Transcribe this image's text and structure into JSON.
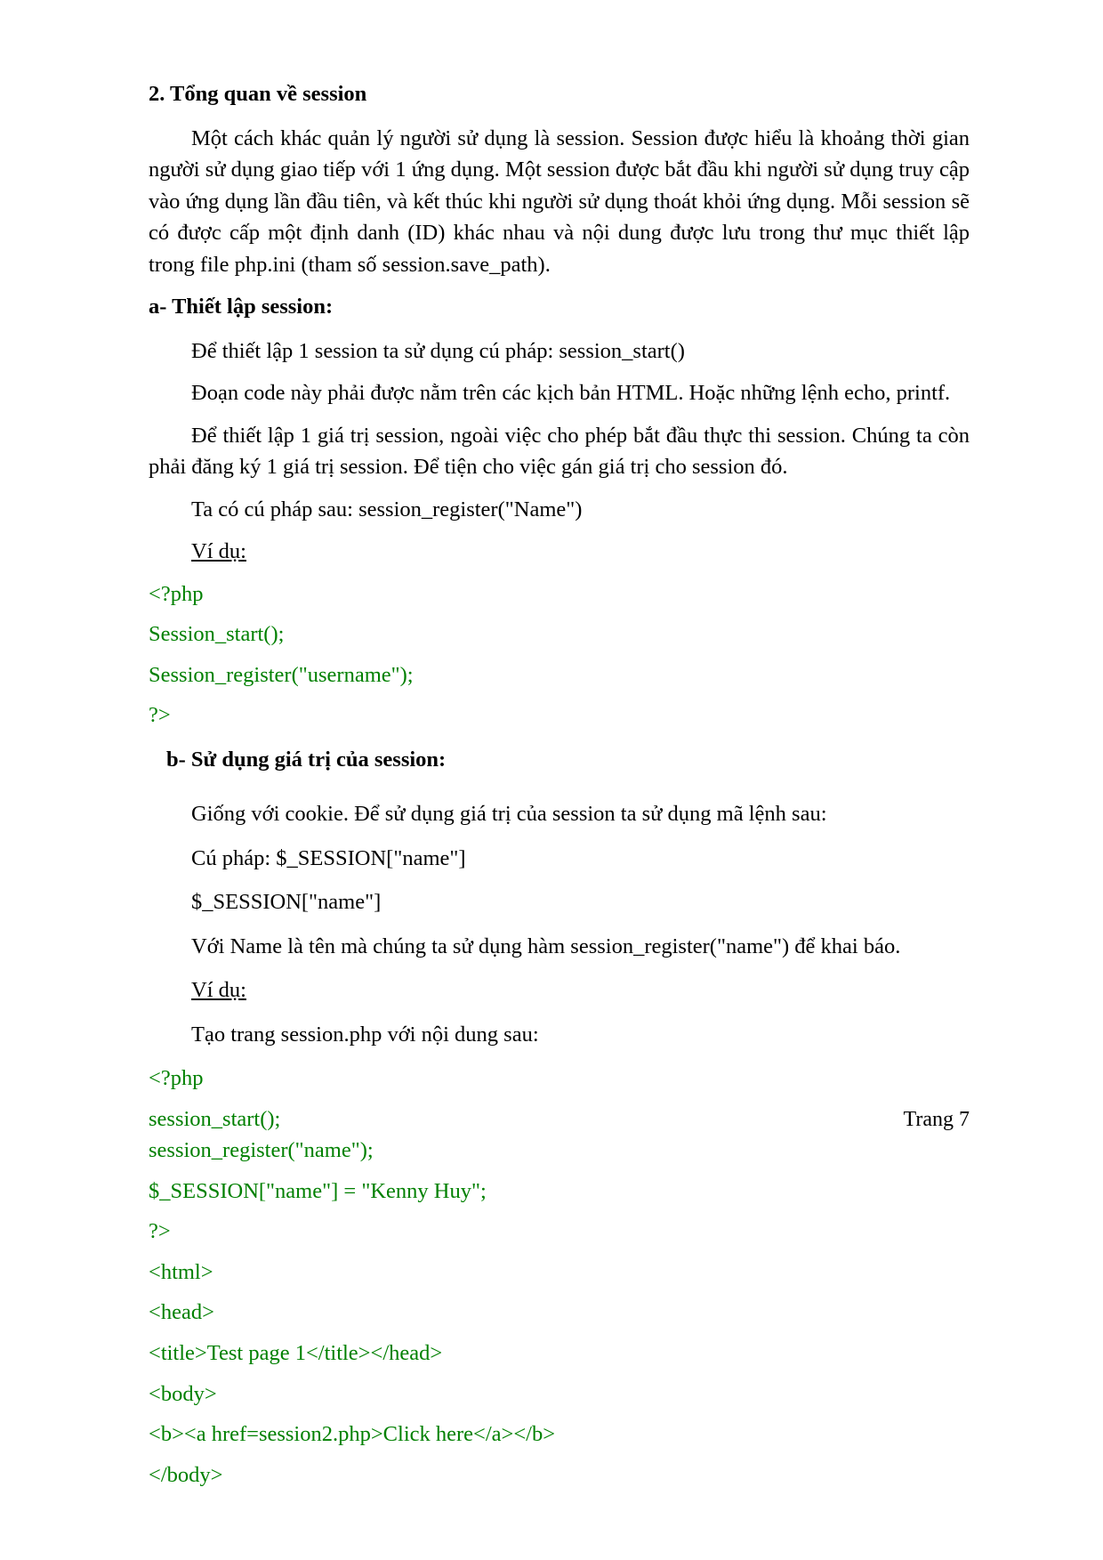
{
  "title": "2. Tổng quan về session",
  "intro": "Một cách khác quản lý người sử dụng là session. Session được hiểu là khoảng thời gian người sử dụng giao tiếp với 1 ứng dụng. Một session được bắt đầu khi người sử dụng truy cập vào ứng dụng lần đầu tiên, và kết thúc khi người sử dụng thoát khỏi ứng dụng. Mỗi session sẽ có được cấp một định danh (ID) khác nhau và nội dung được lưu trong thư mục thiết lập trong file php.ini (tham số session.save_path).",
  "a_title": "a- Thiết lập session:",
  "a_p1": "Để thiết lập 1 session ta sử dụng cú pháp: session_start()",
  "a_p2": "Đoạn code này phải được nằm trên các kịch bản HTML. Hoặc những lệnh echo, printf.",
  "a_p3": "Để thiết lập 1 giá trị session, ngoài việc cho phép bắt đầu thực thi session. Chúng ta còn phải đăng ký 1 giá trị session. Để tiện cho việc gán giá trị cho session đó.",
  "a_p4": "Ta có cú pháp sau: session_register(\"Name\")",
  "vd_label": "Ví dụ:",
  "code1": {
    "l1": "<?php",
    "l2": "Session_start();",
    "l3": "Session_register(\"username\");",
    "l4": "?>"
  },
  "b_title": "b- Sử dụng giá trị của session:",
  "b_p1": "Giống với cookie. Để sử dụng giá trị của session ta sử dụng mã lệnh sau:",
  "b_p2": "Cú pháp: $_SESSION[\"name\"]",
  "b_p3": "$_SESSION[\"name\"]",
  "b_p4": "Với Name là tên mà chúng ta sử dụng hàm session_register(\"name\") để khai báo.",
  "b_vd": "Ví dụ:",
  "b_p5": " Tạo trang session.php với nội dung sau:",
  "code2": {
    "l1": "<?php",
    "l2": "session_start();",
    "l3": "session_register(\"name\");",
    "l4": "$_SESSION[\"name\"] = \"Kenny Huy\";",
    "l5": "?>",
    "l6": "<html>",
    "l7": "<head>",
    "l8": "<title>Test page 1</title></head>",
    "l9": "<body>",
    "l10": "<b><a href=session2.php>Click here</a></b>",
    "l11": "</body>"
  },
  "page_number": "Trang 7"
}
